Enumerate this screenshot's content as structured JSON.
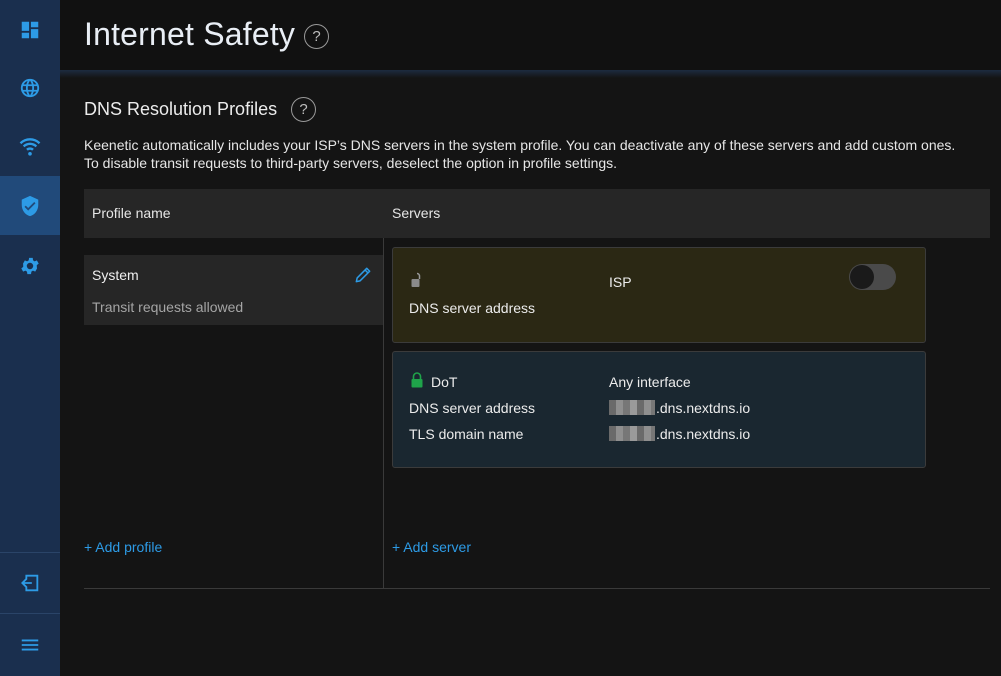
{
  "sidebar": {
    "items": [
      {
        "icon": "dashboard-icon"
      },
      {
        "icon": "globe-icon"
      },
      {
        "icon": "wifi-icon"
      },
      {
        "icon": "shield-check-icon",
        "active": true
      },
      {
        "icon": "gear-icon"
      }
    ],
    "bottom": [
      {
        "icon": "logout-icon"
      },
      {
        "icon": "menu-icon"
      }
    ]
  },
  "header": {
    "title": "Internet Safety",
    "help": "?"
  },
  "section": {
    "title": "DNS Resolution Profiles",
    "help": "?",
    "description_line1": "Keenetic automatically includes your ISP’s DNS servers in the system profile. You can deactivate any of these servers and add custom ones.",
    "description_line2": "To disable transit requests to third-party servers, deselect the option in profile settings."
  },
  "table": {
    "col_profile": "Profile name",
    "col_servers": "Servers"
  },
  "profiles": [
    {
      "name": "System",
      "subtitle": "Transit requests allowed"
    }
  ],
  "servers": [
    {
      "type_label": "ISP",
      "address_label": "DNS server address",
      "enabled": false,
      "accent": "#2b2814"
    },
    {
      "protocol": "DoT",
      "interface": "Any interface",
      "address_label": "DNS server address",
      "address_value": ".dns.nextdns.io",
      "tls_label": "TLS domain name",
      "tls_value": ".dns.nextdns.io",
      "accent": "#1a2730",
      "lock_color": "#1fa34a"
    }
  ],
  "actions": {
    "add_profile": "+ Add profile",
    "add_server": "+ Add server"
  },
  "colors": {
    "accent": "#2d9be6",
    "sidebar": "#1a2f4e",
    "sidebar_active": "#214a7a"
  }
}
